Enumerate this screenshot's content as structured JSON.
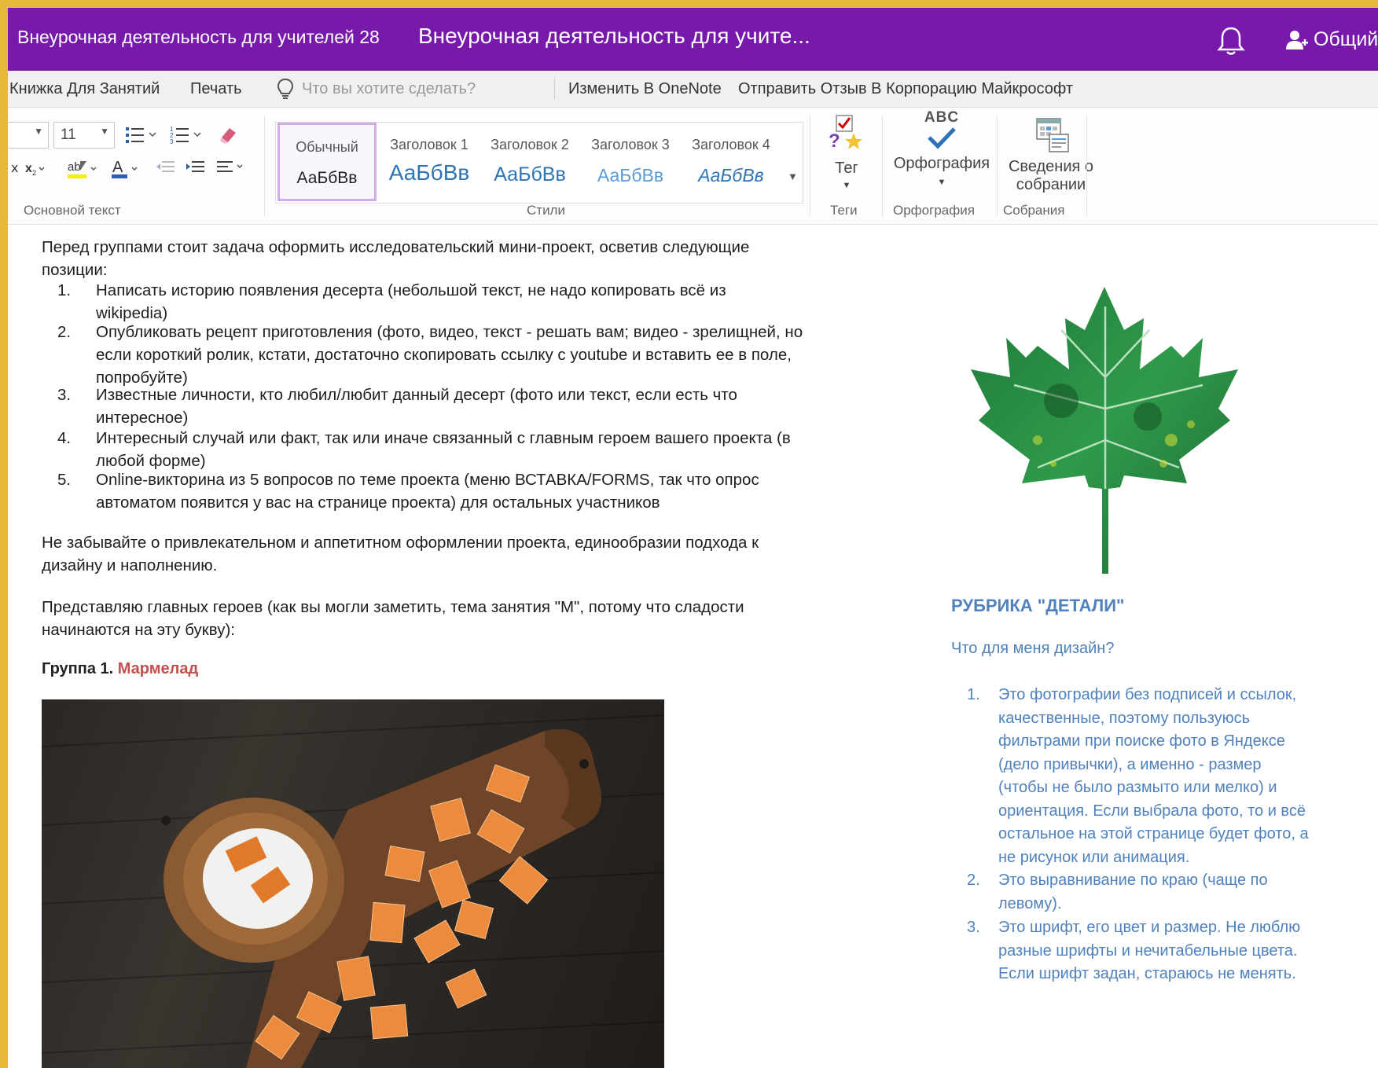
{
  "titlebar": {
    "notebook": "Внеурочная деятельность для учителей 28",
    "page": "Внеурочная деятельность для учите...",
    "share": "Общий"
  },
  "menu": {
    "items": [
      "Книжка Для Занятий",
      "Печать"
    ],
    "tell_placeholder": "Что вы хотите сделать?",
    "edit_in_onenote": "Изменить В OneNote",
    "feedback": "Отправить Отзыв В Корпорацию Майкрософт"
  },
  "ribbon": {
    "font_size": "11",
    "group_basic_text": "Основной текст",
    "styles": [
      {
        "name": "Обычный",
        "sample": "АаБбВв"
      },
      {
        "name": "Заголовок 1",
        "sample": "АаБбВв"
      },
      {
        "name": "Заголовок 2",
        "sample": "АаБбВв"
      },
      {
        "name": "Заголовок 3",
        "sample": "АаБбВв"
      },
      {
        "name": "Заголовок 4",
        "sample": "АаБбВв"
      }
    ],
    "group_styles": "Стили",
    "tag_label": "Тег",
    "group_tags": "Теги",
    "spelling_label": "Орфография",
    "group_spelling": "Орфография",
    "meeting_label_1": "Сведения о",
    "meeting_label_2": "собрании",
    "group_meetings": "Собрания",
    "abc": "ABC"
  },
  "content": {
    "intro_1": "Перед группами стоит задача оформить исследовательский мини-проект, осветив следующие",
    "intro_2": "позиции:",
    "tasks": [
      {
        "num": "1.",
        "lines": [
          "Написать историю появления десерта (небольшой текст, не надо копировать всё из",
          "wikipedia)"
        ]
      },
      {
        "num": "2.",
        "lines": [
          "Опубликовать рецепт приготовления (фото, видео, текст - решать вам; видео - зрелищней, но",
          "если короткий ролик, кстати, достаточно скопировать ссылку с youtube и вставить ее в поле,",
          "попробуйте)"
        ]
      },
      {
        "num": "3.",
        "lines": [
          "Известные личности, кто любил/любит данный десерт (фото или текст, если есть что",
          "интересное)"
        ]
      },
      {
        "num": "4.",
        "lines": [
          "Интересный случай или факт, так или иначе связанный с главным героем вашего проекта (в",
          "любой форме)"
        ]
      },
      {
        "num": "5.",
        "lines": [
          "Online-викторина из 5 вопросов по теме проекта (меню ВСТАВКА/FORMS, так что опрос",
          "автоматом появится у вас на странице проекта) для остальных участников"
        ]
      }
    ],
    "reminder_1": "Не забывайте о привлекательном и аппетитном оформлении проекта, единообразии подхода к",
    "reminder_2": "дизайну и наполнению.",
    "heroes_1": "Представляю главных героев (как вы могли заметить, тема занятия \"М\", потому что сладости",
    "heroes_2": "начинаются на эту букву):",
    "group_label": "Группа 1.",
    "group_name": "Мармелад"
  },
  "sidebar": {
    "rubric": "РУБРИКА \"ДЕТАЛИ\"",
    "question": "Что для меня дизайн?",
    "items": [
      {
        "num": "1.",
        "lines": [
          "Это фотографии без подписей и ссылок,",
          "качественные, поэтому пользуюсь",
          "фильтрами при поиске фото в Яндексе",
          "(дело привычки), а именно - размер",
          "(чтобы не было размыто или мелко) и",
          "ориентация. Если выбрала фото, то и всё",
          "остальное на этой странице будет фото, а",
          "не рисунок или анимация."
        ]
      },
      {
        "num": "2.",
        "lines": [
          "Это выравнивание по краю (чаще по",
          "левому)."
        ]
      },
      {
        "num": "3.",
        "lines": [
          "Это шрифт, его цвет и размер. Не люблю",
          "разные шрифты и нечитабельные цвета.",
          "Если шрифт задан, стараюсь не менять."
        ]
      }
    ]
  },
  "colors": {
    "titlebar": "#7719aa",
    "accent_blue": "#4f81bd",
    "heading_blue": "#2e74b5",
    "red": "#c0504d",
    "frame": "#e8b83a"
  }
}
